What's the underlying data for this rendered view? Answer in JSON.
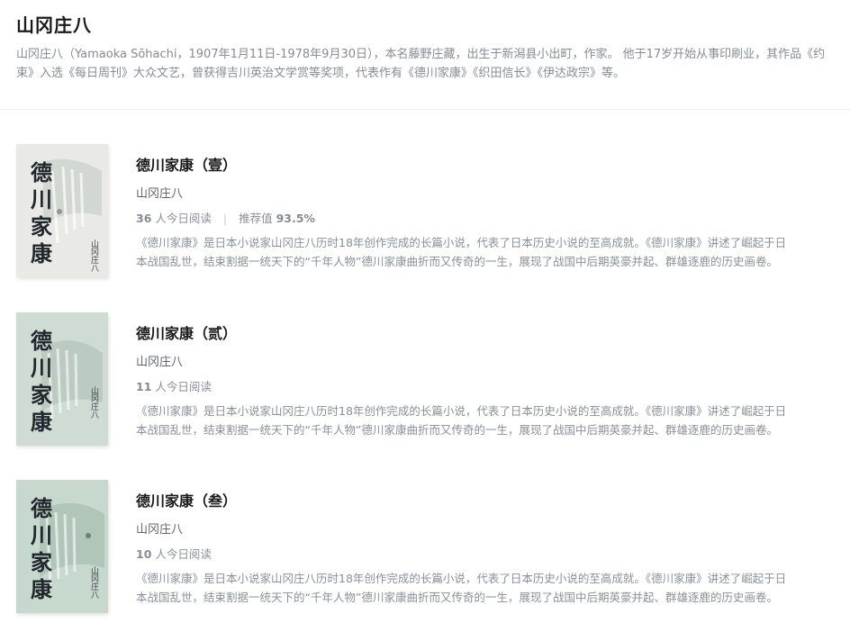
{
  "author": {
    "name": "山冈庄八",
    "bio": "山冈庄八（Yamaoka Sōhachi，1907年1月11日-1978年9月30日），本名藤野庄藏，出生于新潟县小出町，作家。 他于17岁开始从事印刷业，其作品《约束》入选《每日周刊》大众文艺，曾获得吉川英治文学赏等奖项，代表作有《德川家康》《织田信长》《伊达政宗》等。"
  },
  "books": [
    {
      "title": "德川家康（壹）",
      "author": "山冈庄八",
      "readers": "36",
      "readers_label": "人今日阅读",
      "rating_label": "推荐值",
      "rating": "93.5%",
      "description": "《德川家康》是日本小说家山冈庄八历时18年创作完成的长篇小说，代表了日本历史小说的至高成就。《德川家康》讲述了崛起于日本战国乱世，结束割据一统天下的“千年人物”德川家康曲折而又传奇的一生，展现了战国中后期英豪并起、群雄逐鹿的历史画卷。",
      "cover": {
        "spine_text": "德川家康",
        "side_text": "山冈庄八",
        "bg": "#e9eae6",
        "accent": "#c9cfc8"
      }
    },
    {
      "title": "德川家康（贰）",
      "author": "山冈庄八",
      "readers": "11",
      "readers_label": "人今日阅读",
      "description": "《德川家康》是日本小说家山冈庄八历时18年创作完成的长篇小说，代表了日本历史小说的至高成就。《德川家康》讲述了崛起于日本战国乱世，结束割据一统天下的“千年人物”德川家康曲折而又传奇的一生，展现了战国中后期英豪并起、群雄逐鹿的历史画卷。",
      "cover": {
        "spine_text": "德川家康",
        "side_text": "山冈庄八",
        "bg": "#cfdcd4",
        "accent": "#b5c7bb"
      }
    },
    {
      "title": "德川家康（叁）",
      "author": "山冈庄八",
      "readers": "10",
      "readers_label": "人今日阅读",
      "description": "《德川家康》是日本小说家山冈庄八历时18年创作完成的长篇小说，代表了日本历史小说的至高成就。《德川家康》讲述了崛起于日本战国乱世，结束割据一统天下的“千年人物”德川家康曲折而又传奇的一生，展现了战国中后期英豪并起、群雄逐鹿的历史画卷。",
      "cover": {
        "spine_text": "德川家康",
        "side_text": "山冈庄八",
        "bg": "#c7d8ce",
        "accent": "#a9c2b3"
      }
    }
  ]
}
